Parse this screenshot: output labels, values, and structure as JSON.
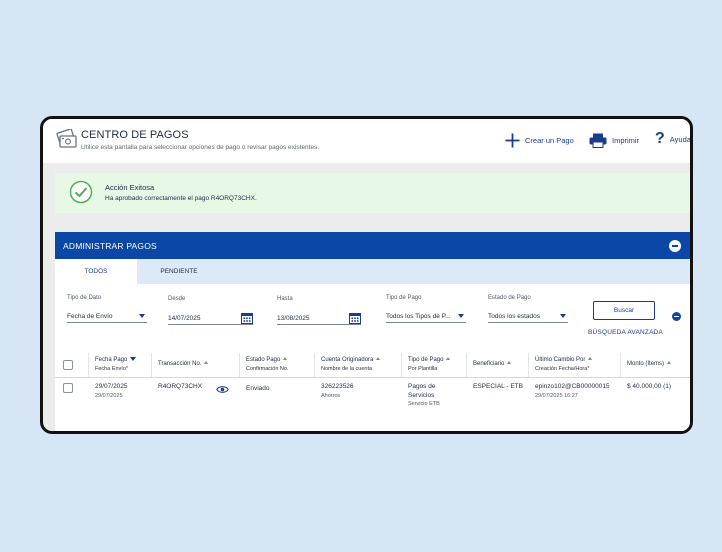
{
  "header": {
    "title": "CENTRO DE PAGOS",
    "subtitle": "Utilice esta pantalla para seleccionar opciones de pago o revisar pagos existentes.",
    "actions": {
      "create": "Crear un Pago",
      "print": "Imprimir",
      "help": "Ayuda"
    }
  },
  "banner": {
    "title": "Acción Exitosa",
    "message": "Ha aprobado correctamente el pago R4ORQ73CHX."
  },
  "panel": {
    "title": "ADMINISTRAR PAGOS",
    "tabs": [
      "TODOS",
      "PENDIENTE"
    ],
    "active_tab": "TODOS"
  },
  "filters": {
    "date_type": {
      "label": "Tipo de Dato",
      "value": "Fecha de Envío"
    },
    "from": {
      "label": "Desde",
      "value": "14/07/2025"
    },
    "to": {
      "label": "Hasta",
      "value": "13/08/2025"
    },
    "payment_type": {
      "label": "Tipo de Pago",
      "value": "Todos los Tipos de P..."
    },
    "status": {
      "label": "Estado de Pago",
      "value": "Todos los estados"
    },
    "search_button": "Buscar",
    "advanced_search": "BÚSQUEDA AVANZADA"
  },
  "table": {
    "columns": [
      {
        "l1": "Fecha Pago",
        "l2": "Fecha Envío"
      },
      {
        "l1": "Transacción No.",
        "l2": ""
      },
      {
        "l1": "Estado Pago",
        "l2": "Confirmación No."
      },
      {
        "l1": "Cuenta Originadora",
        "l2": "Nombre de la cuenta"
      },
      {
        "l1": "Tipo de Pago",
        "l2": "Por Plantilla"
      },
      {
        "l1": "Beneficiario",
        "l2": ""
      },
      {
        "l1": "Último Cambio Por",
        "l2": "Creación Fecha/Hora"
      },
      {
        "l1": "Monto (Items)",
        "l2": ""
      }
    ],
    "rows": [
      {
        "payment_date": "29/07/2025",
        "send_date": "29/07/2025",
        "transaction": "R4ORQ73CHX",
        "status": "Enviado",
        "account": "326223526",
        "account_name": "Ahorros",
        "type_l1": "Pagos de",
        "type_l2": "Servicios",
        "template": "Servicio ETB",
        "beneficiary": "ESPECIAL - ETB",
        "changed_by": "epinzo102@CB00000015",
        "created": "29/07/2025 16:27",
        "amount": "$ 40.000,00 (1)"
      }
    ]
  },
  "colors": {
    "brand_blue": "#0a47a6",
    "success_bg": "#e7f8e6",
    "success_icon": "#4caf50",
    "background": "#d6e6f5"
  }
}
